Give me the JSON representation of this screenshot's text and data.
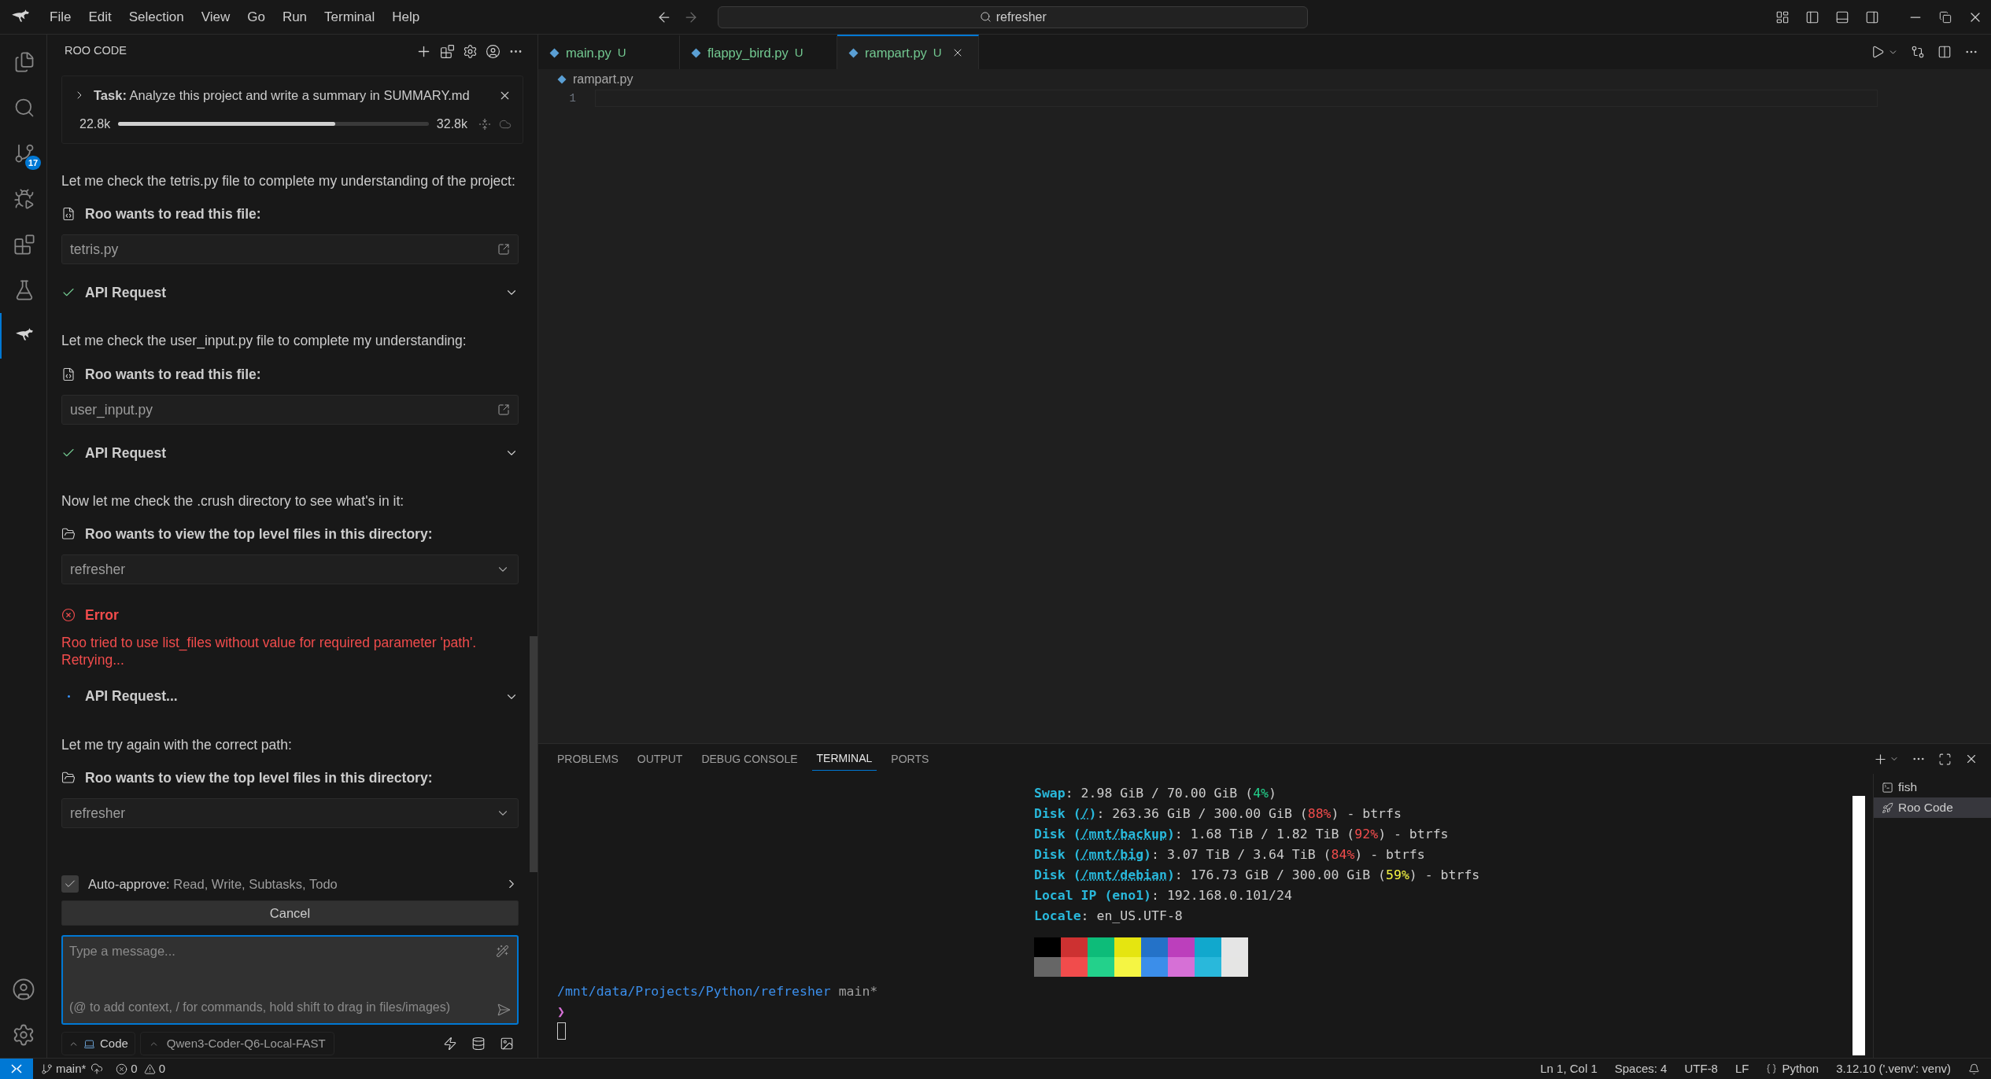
{
  "menu": [
    "File",
    "Edit",
    "Selection",
    "View",
    "Go",
    "Run",
    "Terminal",
    "Help"
  ],
  "title_search": "refresher",
  "activity": [
    {
      "selected": false
    },
    {
      "selected": false
    },
    {
      "selected": false,
      "badge": "17"
    },
    {
      "selected": false
    },
    {
      "selected": false
    },
    {
      "selected": false
    },
    {
      "selected": true
    }
  ],
  "roo": {
    "title": "ROO CODE",
    "task": {
      "label": "Task:",
      "text": "Analyze this project and write a summary in SUMMARY.md",
      "tokens_used": "22.8k",
      "context_window": "32.8k",
      "level": 0.7
    },
    "messages": [
      {
        "kind": "text",
        "text": "Let me check the tetris.py file to complete my understanding of the project:"
      },
      {
        "kind": "read_file",
        "title": "Roo wants to read this file:",
        "value": "tetris.py"
      },
      {
        "kind": "api",
        "done": true,
        "title": "API Request"
      },
      {
        "kind": "text",
        "text": "Let me check the user_input.py file to complete my understanding:"
      },
      {
        "kind": "read_file",
        "title": "Roo wants to read this file:",
        "value": "user_input.py"
      },
      {
        "kind": "api",
        "done": true,
        "title": "API Request"
      },
      {
        "kind": "text",
        "text": "Now let me check the .crush directory to see what's in it:"
      },
      {
        "kind": "list_dir",
        "title": "Roo wants to view the top level files in this directory:",
        "value": "refresher"
      },
      {
        "kind": "error",
        "title": "Error",
        "text": "Roo tried to use list_files without value for required parameter 'path'. Retrying..."
      },
      {
        "kind": "api",
        "done": false,
        "title": "API Request..."
      },
      {
        "kind": "text",
        "text": "Let me try again with the correct path:"
      },
      {
        "kind": "list_dir",
        "title": "Roo wants to view the top level files in this directory:",
        "value": "refresher"
      }
    ],
    "auto_approve": {
      "checked": true,
      "label": "Auto-approve:",
      "items": "Read, Write, Subtasks, Todo"
    },
    "cancel": "Cancel",
    "input": {
      "placeholder": "Type a message...",
      "hint": "(@ to add context, / for commands, hold shift to drag in files/images)"
    },
    "mode": "Code",
    "model": "Qwen3-Coder-Q6-Local-FAST"
  },
  "editor": {
    "tabs": [
      {
        "label": "main.py",
        "badge": "U",
        "selected": false
      },
      {
        "label": "flappy_bird.py",
        "badge": "U",
        "selected": false
      },
      {
        "label": "rampart.py",
        "badge": "U",
        "selected": true
      }
    ],
    "breadcrumb": "rampart.py",
    "line_numbers": [
      "1"
    ]
  },
  "panel": {
    "tabs": [
      {
        "label": "PROBLEMS",
        "selected": false
      },
      {
        "label": "OUTPUT",
        "selected": false
      },
      {
        "label": "DEBUG CONSOLE",
        "selected": false
      },
      {
        "label": "TERMINAL",
        "selected": true
      },
      {
        "label": "PORTS",
        "selected": false
      }
    ],
    "terminal": {
      "lines": [
        [
          {
            "kind": "key",
            "text": "Swap"
          },
          {
            "kind": "text",
            "text": ": 2.98 GiB / 70.00 GiB ("
          },
          {
            "kind": "pct",
            "text": "4%",
            "color": "#23d18b"
          },
          {
            "kind": "text",
            "text": ")"
          }
        ],
        [
          {
            "kind": "key",
            "text": "Disk ("
          },
          {
            "kind": "link",
            "text": "/"
          },
          {
            "kind": "key",
            "text": ")"
          },
          {
            "kind": "text",
            "text": ": 263.36 GiB / 300.00 GiB ("
          },
          {
            "kind": "pct",
            "text": "88%",
            "color": "#f14c4c"
          },
          {
            "kind": "text",
            "text": ") - btrfs"
          }
        ],
        [
          {
            "kind": "key",
            "text": "Disk ("
          },
          {
            "kind": "link",
            "text": "/mnt/backup"
          },
          {
            "kind": "key",
            "text": ")"
          },
          {
            "kind": "text",
            "text": ": 1.68 TiB / 1.82 TiB ("
          },
          {
            "kind": "pct",
            "text": "92%",
            "color": "#f14c4c"
          },
          {
            "kind": "text",
            "text": ") - btrfs"
          }
        ],
        [
          {
            "kind": "key",
            "text": "Disk ("
          },
          {
            "kind": "link",
            "text": "/mnt/big"
          },
          {
            "kind": "key",
            "text": ")"
          },
          {
            "kind": "text",
            "text": ": 3.07 TiB / 3.64 TiB ("
          },
          {
            "kind": "pct",
            "text": "84%",
            "color": "#f14c4c"
          },
          {
            "kind": "text",
            "text": ") - btrfs"
          }
        ],
        [
          {
            "kind": "key",
            "text": "Disk ("
          },
          {
            "kind": "link",
            "text": "/mnt/debian"
          },
          {
            "kind": "key",
            "text": ")"
          },
          {
            "kind": "text",
            "text": ": 176.73 GiB / 300.00 GiB ("
          },
          {
            "kind": "pct",
            "text": "59%",
            "color": "#f5f543"
          },
          {
            "kind": "text",
            "text": ") - btrfs"
          }
        ],
        [
          {
            "kind": "key",
            "text": "Local IP (eno1)"
          },
          {
            "kind": "text",
            "text": ": 192.168.0.101/24"
          }
        ],
        [
          {
            "kind": "key",
            "text": "Locale"
          },
          {
            "kind": "text",
            "text": ": en_US.UTF-8"
          }
        ]
      ],
      "palette": [
        [
          {
            "color": "#000000"
          },
          {
            "color": "#cd3131"
          },
          {
            "color": "#0dbc79"
          },
          {
            "color": "#e5e510"
          },
          {
            "color": "#2472c8"
          },
          {
            "color": "#bc3fbc"
          },
          {
            "color": "#11a8cd"
          },
          {
            "color": "#e5e5e5"
          }
        ],
        [
          {
            "color": "#666666"
          },
          {
            "color": "#f14c4c"
          },
          {
            "color": "#23d18b"
          },
          {
            "color": "#f5f543"
          },
          {
            "color": "#3b8eea"
          },
          {
            "color": "#d670d6"
          },
          {
            "color": "#29b8db"
          },
          {
            "color": "#e5e5e4"
          }
        ]
      ],
      "cwd": "/mnt/data/Projects/Python/refresher",
      "branch": "main*",
      "prompt": "❯"
    },
    "sessions": [
      {
        "label": "fish",
        "selected": false
      },
      {
        "label": "Roo Code",
        "selected": true
      }
    ]
  },
  "status_bar": {
    "branch": "main*",
    "errors": "0",
    "warnings": "0",
    "right": [
      {
        "kind": "text",
        "text": "Ln 1, Col 1"
      },
      {
        "kind": "text",
        "text": "Spaces: 4"
      },
      {
        "kind": "text",
        "text": "UTF-8"
      },
      {
        "kind": "text",
        "text": "LF"
      },
      {
        "kind": "language",
        "text": "Python"
      },
      {
        "kind": "text",
        "text": "3.12.10 ('.venv': venv)"
      }
    ]
  }
}
